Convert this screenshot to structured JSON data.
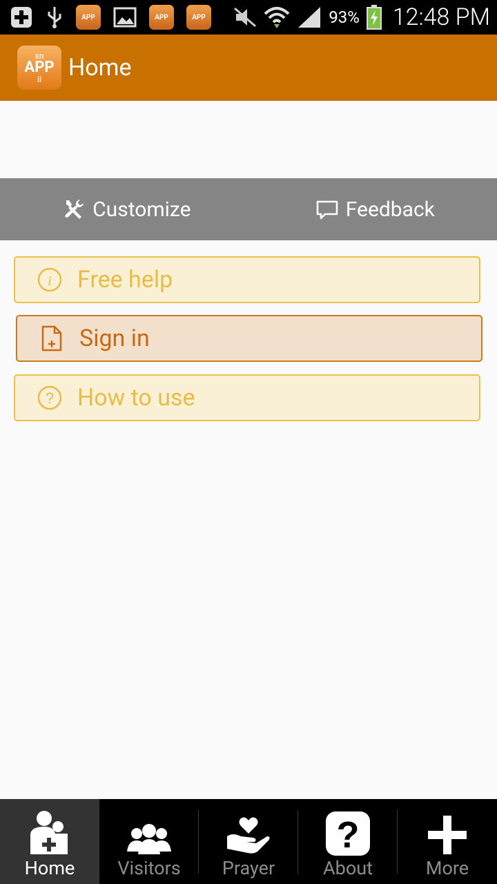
{
  "statusbar": {
    "battery_percent": "93%",
    "time": "12:48 PM",
    "app_icon_label": "APP",
    "icons": [
      "add-box-icon",
      "usb-icon",
      "app-icon",
      "image-icon",
      "app-icon",
      "app-icon",
      "mute-icon",
      "wifi-icon",
      "signal-icon",
      "battery-charging-icon"
    ]
  },
  "actionbar": {
    "logo_top": "sn",
    "logo_main": "APP",
    "logo_bottom": "ii",
    "title": "Home"
  },
  "toolbar": {
    "customize_label": "Customize",
    "feedback_label": "Feedback"
  },
  "buttons": [
    {
      "label": "Free help",
      "icon": "info-icon"
    },
    {
      "label": "Sign in",
      "icon": "document-add-icon",
      "active": true
    },
    {
      "label": "How to use",
      "icon": "question-icon"
    }
  ],
  "bottomnav": [
    {
      "label": "Home",
      "icon": "home-church-icon",
      "active": true
    },
    {
      "label": "Visitors",
      "icon": "people-icon"
    },
    {
      "label": "Prayer",
      "icon": "heart-hand-icon"
    },
    {
      "label": "About",
      "icon": "question-box-icon"
    },
    {
      "label": "More",
      "icon": "plus-icon"
    }
  ],
  "colors": {
    "actionbar": "#c87000",
    "toolbar": "#858585",
    "button_bg": "#faf0d6",
    "button_border": "#e8c24a",
    "active_bg": "#f2e0cc",
    "active_text": "#c86a12"
  }
}
